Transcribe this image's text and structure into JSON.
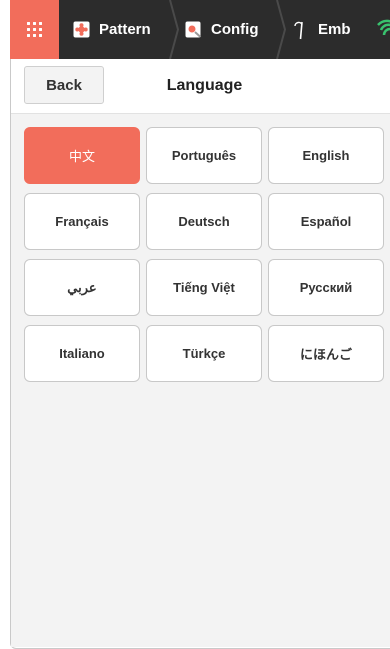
{
  "app": {
    "accent_color": "#f26d5b",
    "topbar_color": "#2c2c2c",
    "menu_icon": "grid-menu-icon",
    "wifi_icon": "wifi-icon"
  },
  "tabs": [
    {
      "label": "Pattern",
      "icon": "pattern-icon"
    },
    {
      "label": "Config",
      "icon": "config-icon"
    },
    {
      "label": "Emb",
      "icon": "needle-icon"
    }
  ],
  "header": {
    "back_label": "Back",
    "title": "Language"
  },
  "languages": [
    {
      "label": "中文",
      "selected": true
    },
    {
      "label": "Português",
      "selected": false
    },
    {
      "label": "English",
      "selected": false
    },
    {
      "label": "Français",
      "selected": false
    },
    {
      "label": "Deutsch",
      "selected": false
    },
    {
      "label": "Español",
      "selected": false
    },
    {
      "label": "عربي",
      "selected": false
    },
    {
      "label": "Tiếng Việt",
      "selected": false
    },
    {
      "label": "Русский",
      "selected": false
    },
    {
      "label": "Italiano",
      "selected": false
    },
    {
      "label": "Türkçe",
      "selected": false
    },
    {
      "label": "にほんご",
      "selected": false
    }
  ]
}
